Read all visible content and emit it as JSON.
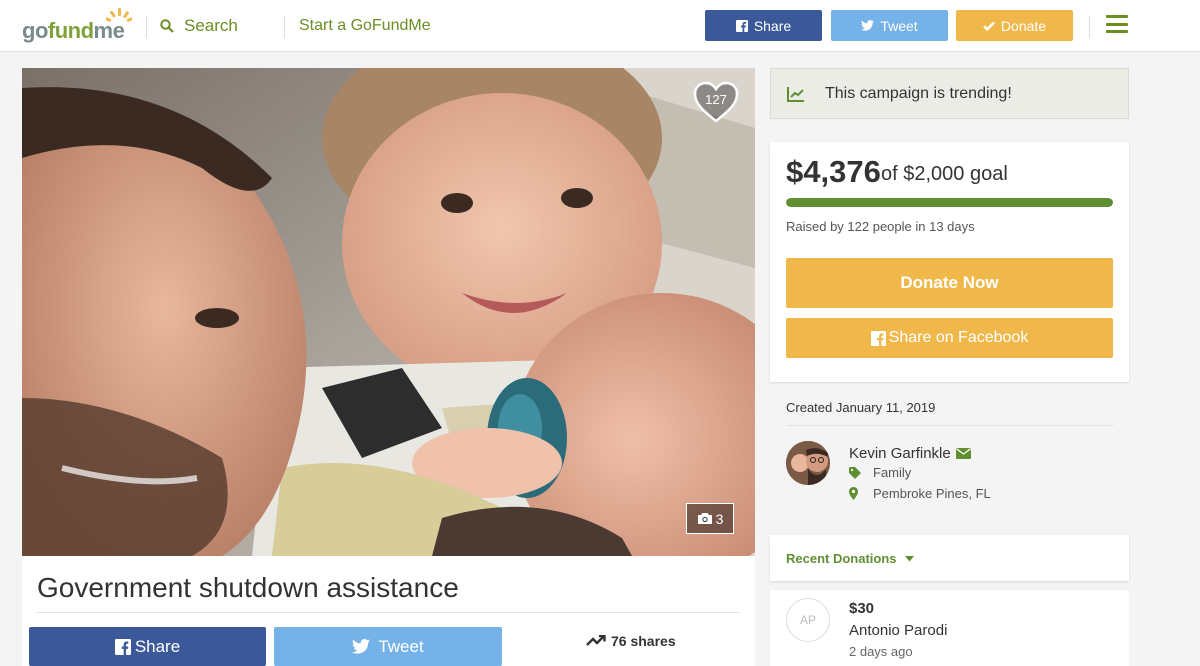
{
  "header": {
    "logo_text_prefix": "go",
    "logo_text_mid": "fund",
    "logo_text_suffix": "me",
    "search_label": "Search",
    "start_label": "Start a GoFundMe",
    "share_label": "Share",
    "tweet_label": "Tweet",
    "donate_label": "Donate"
  },
  "hero": {
    "heart_count": "127",
    "photo_count": "3"
  },
  "campaign": {
    "title": "Government shutdown assistance",
    "share_label": "Share",
    "tweet_label": "Tweet",
    "shares_count": "76 shares"
  },
  "sidebar": {
    "trending_text": "This campaign is trending!",
    "raised_amount": "$4,376",
    "goal_text": "of $2,000 goal",
    "progress_fraction": 1.0,
    "raised_by": "Raised by 122 people in 13 days",
    "donate_now_label": "Donate Now",
    "share_facebook_label": "Share on Facebook",
    "created": "Created January 11, 2019",
    "organizer_name": "Kevin Garfinkle",
    "organizer_category": "Family",
    "organizer_location": "Pembroke Pines, FL",
    "recent_donations_label": "Recent Donations",
    "donation": {
      "initials": "AP",
      "amount": "$30",
      "name": "Antonio Parodi",
      "time": "2 days ago"
    }
  },
  "colors": {
    "brand_green": "#6b8e23",
    "facebook_blue": "#3b5998",
    "twitter_blue": "#74b2e8",
    "donate_orange": "#f0b84a",
    "progress_green": "#5f8f31"
  }
}
